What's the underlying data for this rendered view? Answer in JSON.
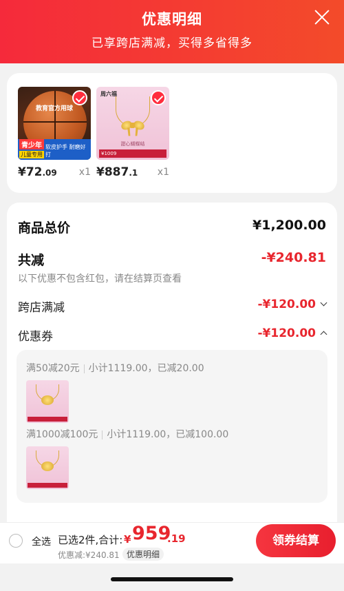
{
  "header": {
    "title": "优惠明细",
    "subtitle": "已享跨店满减，买得多省得多"
  },
  "products": [
    {
      "price_int": "¥72",
      "price_dec": ".09",
      "qty": "x1",
      "image_text": "教育官方用球",
      "tag1": "青少年",
      "tag2": "儿童专用",
      "tag3": "软皮护手 耐磨好打"
    },
    {
      "price_int": "¥887",
      "price_dec": ".1",
      "qty": "x1",
      "logo_text": "周六福",
      "caption": "甜心蝴蝶结",
      "bar_text": "¥1009"
    }
  ],
  "summary": {
    "total_label": "商品总价",
    "total_value": "¥1,200.00",
    "reduce_label": "共减",
    "reduce_value": "-¥240.81",
    "note": "以下优惠不包含红包，请在结算页查看",
    "cross_store_label": "跨店满减",
    "cross_store_value": "-¥120.00",
    "coupon_label": "优惠券",
    "coupon_value": "-¥120.00"
  },
  "coupons": [
    {
      "rule": "满50减20元",
      "detail": "小计1119.00，已减20.00"
    },
    {
      "rule": "满1000减100元",
      "detail": "小计1119.00，已减100.00"
    }
  ],
  "bottom_bar": {
    "select_all": "全选",
    "selected": "已选2件,合计:",
    "currency": "¥",
    "total_int": "959",
    "total_dec": ".19",
    "discount": "优惠减:¥240.81",
    "detail_link": "优惠明细",
    "checkout": "领券结算"
  },
  "colors": {
    "accent": "#e8262e",
    "header_gradient_start": "#f52a3b",
    "header_gradient_end": "#f34b2a"
  }
}
